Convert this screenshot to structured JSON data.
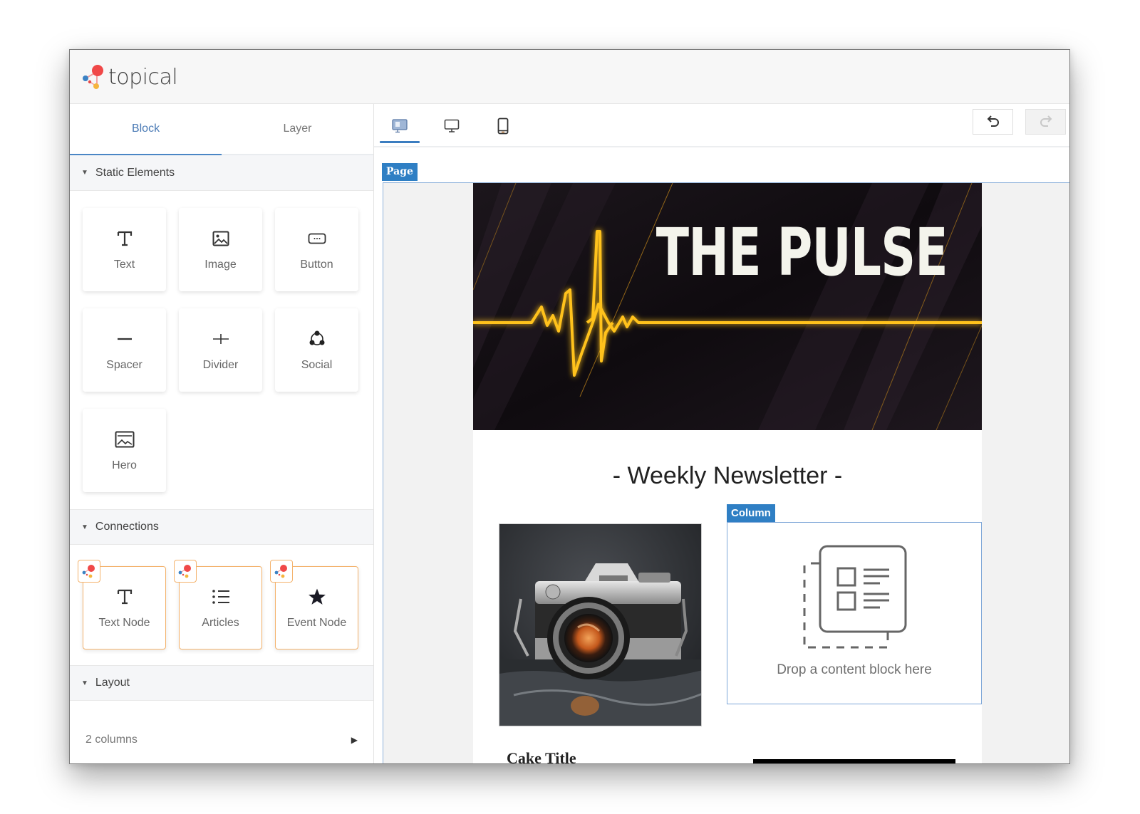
{
  "app": {
    "brand_name": "topical",
    "logo_colors": {
      "red": "#f04848",
      "blue": "#3b82c4",
      "yellow": "#f5b53d"
    }
  },
  "sidebar": {
    "tabs": [
      {
        "label": "Block",
        "active": true
      },
      {
        "label": "Layer",
        "active": false
      }
    ],
    "sections": {
      "static": {
        "title": "Static Elements",
        "items": [
          {
            "label": "Text",
            "icon": "text-icon"
          },
          {
            "label": "Image",
            "icon": "image-icon"
          },
          {
            "label": "Button",
            "icon": "button-icon"
          },
          {
            "label": "Spacer",
            "icon": "spacer-icon"
          },
          {
            "label": "Divider",
            "icon": "divider-icon"
          },
          {
            "label": "Social",
            "icon": "social-icon"
          },
          {
            "label": "Hero",
            "icon": "hero-icon"
          }
        ]
      },
      "connections": {
        "title": "Connections",
        "items": [
          {
            "label": "Text Node",
            "icon": "text-icon"
          },
          {
            "label": "Articles",
            "icon": "list-icon"
          },
          {
            "label": "Event Node",
            "icon": "star-icon"
          }
        ]
      },
      "layout": {
        "title": "Layout",
        "items": [
          {
            "label": "2 columns",
            "icon": "caret-right-icon"
          }
        ]
      }
    }
  },
  "toolbar": {
    "devices": [
      {
        "name": "responsive",
        "active": true
      },
      {
        "name": "desktop",
        "active": false
      },
      {
        "name": "mobile",
        "active": false
      }
    ],
    "undo_enabled": true,
    "redo_enabled": false
  },
  "canvas": {
    "page_label": "Page",
    "column_label": "Column",
    "banner_title": "THE PULSE",
    "headline": "- Weekly Newsletter -",
    "drop_placeholder": "Drop a content block here",
    "article_title": "Cake Title",
    "accent_color": "#2f7fc4",
    "pulse_color": "#ffc21a"
  }
}
